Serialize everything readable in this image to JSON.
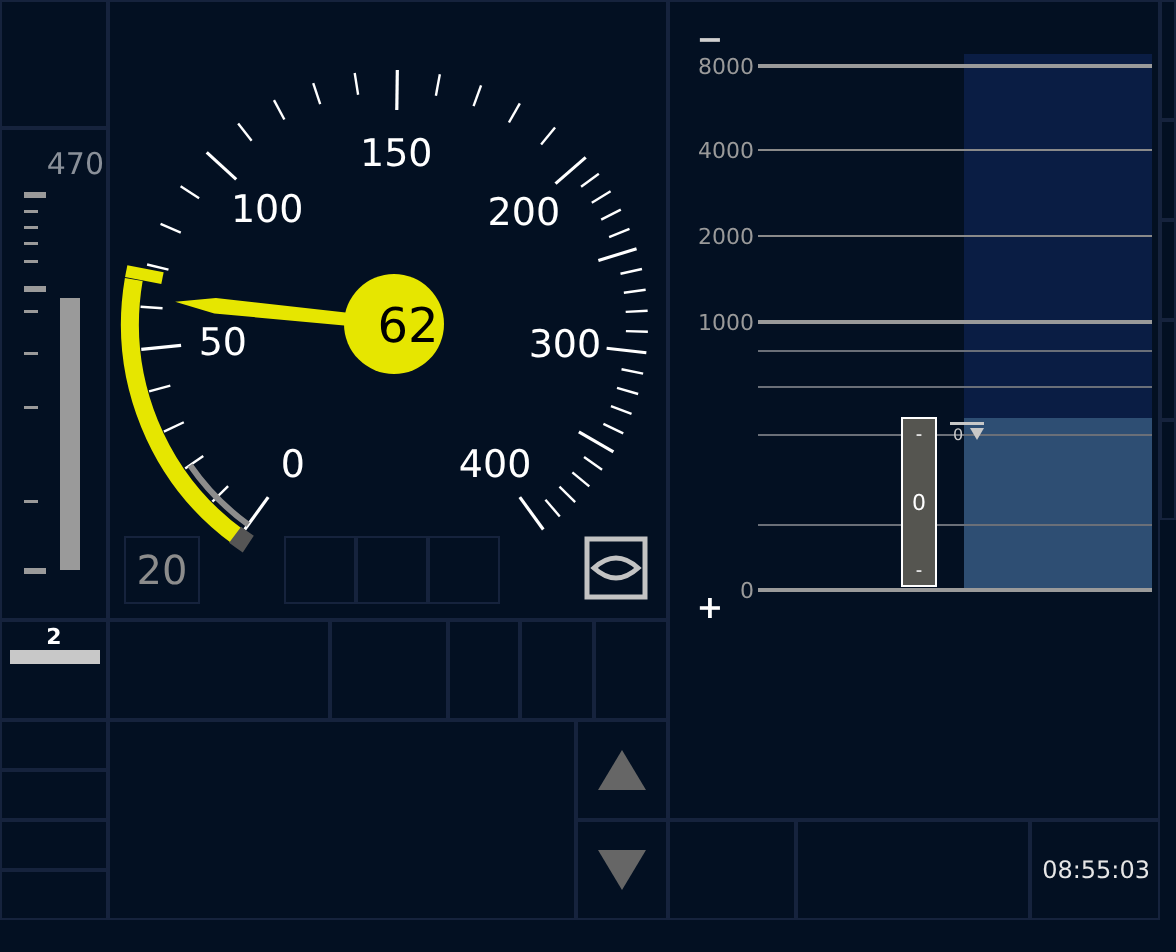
{
  "distance_to_target": {
    "label": "470"
  },
  "speed_dial": {
    "scale_labels": [
      "0",
      "50",
      "100",
      "150",
      "200",
      "300",
      "400"
    ],
    "speed": "62"
  },
  "target_speed": "20",
  "level_indicator": {
    "label": "2"
  },
  "planning": {
    "zoom_out": "−",
    "zoom_in": "+",
    "distance_labels": [
      "8000",
      "4000",
      "2000",
      "1000",
      "0"
    ],
    "gradient": {
      "labels": [
        "-",
        "0",
        "-"
      ]
    },
    "speed_marker": {
      "label": "0"
    }
  },
  "clock": "08:55:03"
}
